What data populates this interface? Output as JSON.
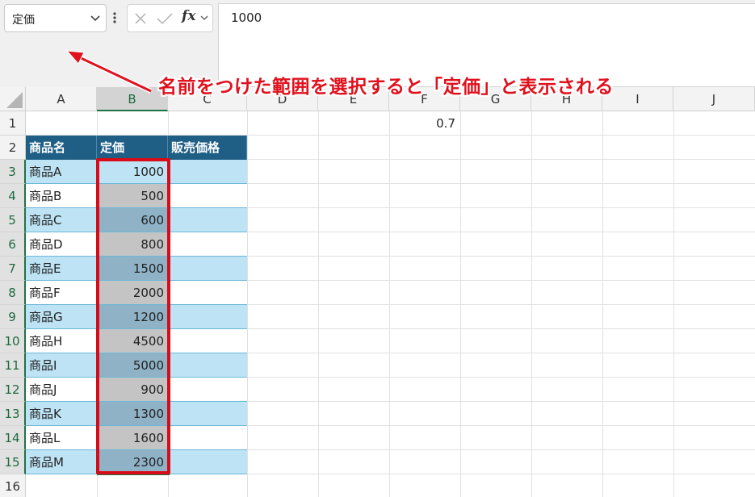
{
  "name_box": {
    "value": "定価"
  },
  "formula_bar": {
    "function_symbol": "fx",
    "value": "1000"
  },
  "callout": {
    "text": "名前をつけた範囲を選択すると「定価」と表示される",
    "color": "#e0111d"
  },
  "columns": [
    "A",
    "B",
    "C",
    "D",
    "E",
    "F",
    "G",
    "H",
    "I",
    "J"
  ],
  "rows": [
    "1",
    "2",
    "3",
    "4",
    "5",
    "6",
    "7",
    "8",
    "9",
    "10",
    "11",
    "12",
    "13",
    "14",
    "15",
    "16"
  ],
  "cell_F1": "0.7",
  "table": {
    "headers": [
      "商品名",
      "定価",
      "販売価格"
    ],
    "rows": [
      {
        "name": "商品A",
        "price": "1000",
        "sale": ""
      },
      {
        "name": "商品B",
        "price": "500",
        "sale": ""
      },
      {
        "name": "商品C",
        "price": "600",
        "sale": ""
      },
      {
        "name": "商品D",
        "price": "800",
        "sale": ""
      },
      {
        "name": "商品E",
        "price": "1500",
        "sale": ""
      },
      {
        "name": "商品F",
        "price": "2000",
        "sale": ""
      },
      {
        "name": "商品G",
        "price": "1200",
        "sale": ""
      },
      {
        "name": "商品H",
        "price": "4500",
        "sale": ""
      },
      {
        "name": "商品I",
        "price": "5000",
        "sale": ""
      },
      {
        "name": "商品J",
        "price": "900",
        "sale": ""
      },
      {
        "name": "商品K",
        "price": "1300",
        "sale": ""
      },
      {
        "name": "商品L",
        "price": "1600",
        "sale": ""
      },
      {
        "name": "商品M",
        "price": "2300",
        "sale": ""
      }
    ]
  },
  "colors": {
    "header_fill": "#1f5f86",
    "band_fill": "#bde3f4",
    "selection": "#217346",
    "highlight_box": "#d80c18"
  }
}
